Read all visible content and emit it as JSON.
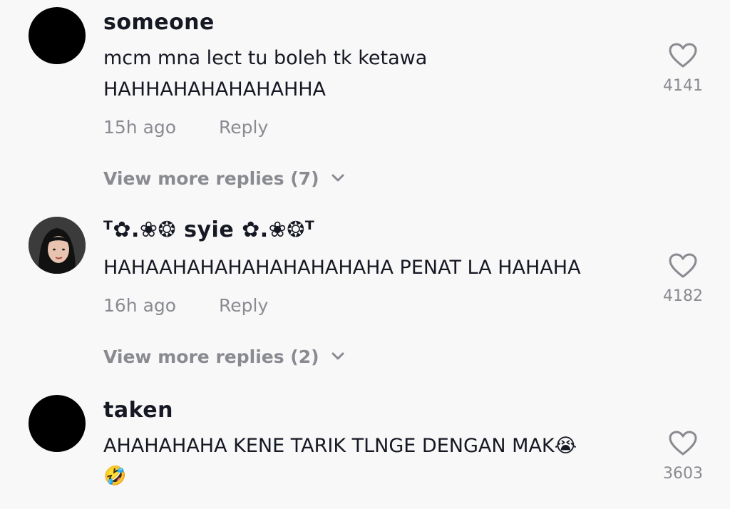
{
  "comments": [
    {
      "username": "someone",
      "lines": [
        "mcm mna lect tu boleh tk ketawa",
        "HAHHAHAHAHAHAHHA"
      ],
      "time": "15h ago",
      "reply_label": "Reply",
      "likes": "4141",
      "view_more": "View more replies (7)",
      "avatar": "black-circle"
    },
    {
      "username": "ᵀ✿.❀❂ syie ✿.❀❂ᵀ",
      "lines": [
        "HAHAAHAHAHAHAHAHAHAHA PENAT LA HAHAHA"
      ],
      "time": "16h ago",
      "reply_label": "Reply",
      "likes": "4182",
      "view_more": "View more replies (2)",
      "avatar": "photo"
    },
    {
      "username": "taken",
      "lines": [
        "AHAHAHAHA KENE TARIK TLNGE DENGAN MAK😭",
        "🤣"
      ],
      "likes": "3603",
      "avatar": "black-circle"
    }
  ],
  "icons": {
    "like": "heart-outline-icon",
    "expand": "chevron-down-icon"
  },
  "colors": {
    "background": "#f8f8f8",
    "text": "#161823",
    "muted": "#8a8b91"
  }
}
